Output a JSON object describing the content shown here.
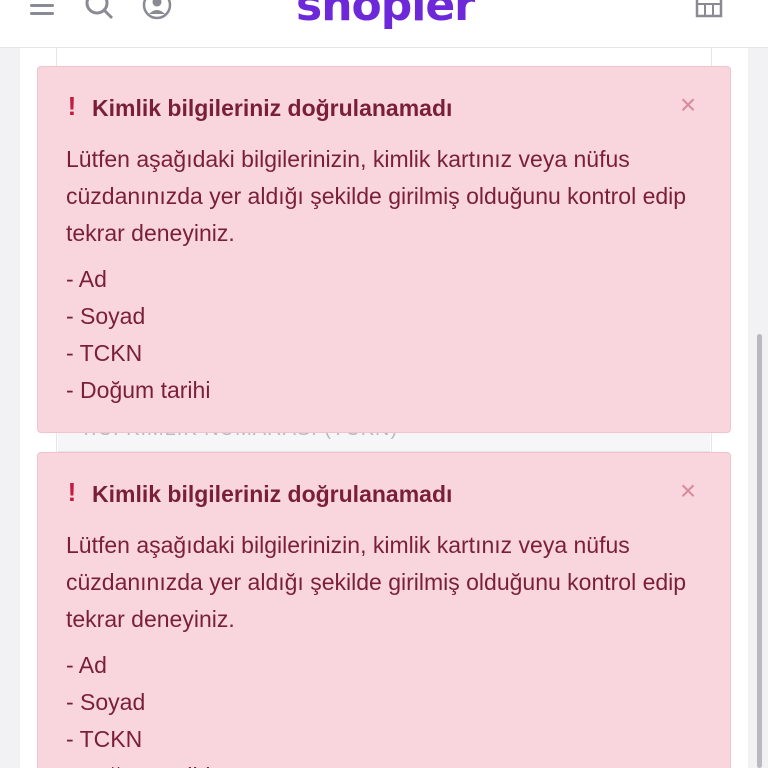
{
  "header": {
    "logo": "shopier",
    "icons": [
      "menu-icon",
      "search-icon",
      "user-icon",
      "cart-icon"
    ]
  },
  "background": {
    "field_label": "T.C. KİMLİK NUMARASI (TCKN)"
  },
  "alerts": [
    {
      "title": "Kimlik bilgileriniz doğrulanamadı",
      "close": "×",
      "message": "Lütfen aşağıdaki bilgilerinizin, kimlik kartınız veya nüfus cüzdanınızda yer aldığı şekilde girilmiş olduğunu kontrol edip tekrar deneyiniz.",
      "items": [
        "- Ad",
        "- Soyad",
        "- TCKN",
        "- Doğum tarihi"
      ]
    },
    {
      "title": "Kimlik bilgileriniz doğrulanamadı",
      "close": "×",
      "message": "Lütfen aşağıdaki bilgilerinizin, kimlik kartınız veya nüfus cüzdanınızda yer aldığı şekilde girilmiş olduğunu kontrol edip tekrar deneyiniz.",
      "items": [
        "- Ad",
        "- Soyad",
        "- TCKN",
        "- Doğum tarihi"
      ]
    }
  ],
  "colors": {
    "brand": "#6d28d9",
    "alert_bg": "#f9d6dd",
    "alert_text": "#7a1f3a",
    "alert_icon": "#c21d3f"
  }
}
